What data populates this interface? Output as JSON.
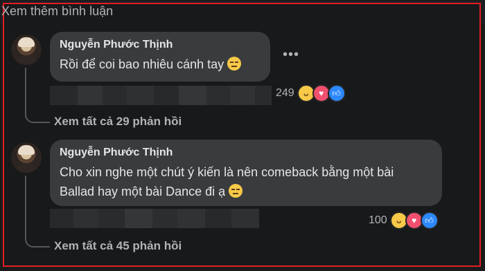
{
  "header": {
    "see_more_comments": "Xem thêm bình luận"
  },
  "comments": [
    {
      "author": "Nguyễn Phước Thịnh",
      "text": "Rồi để coi bao nhiêu cánh tay",
      "emoji": "smirking-face",
      "reaction_count": "249",
      "reactions": [
        "haha",
        "love",
        "like"
      ],
      "replies_label": "Xem tất cả 29 phản hồi"
    },
    {
      "author": "Nguyễn Phước Thịnh",
      "text_line1": "Cho xin nghe một chút ý kiến là nên comeback bằng một bài",
      "text_line2": "Ballad hay một bài Dance đi ạ",
      "emoji": "expressionless-face",
      "reaction_count": "100",
      "reactions": [
        "haha",
        "love",
        "like"
      ],
      "replies_label": "Xem tất cả 45 phản hồi"
    }
  ],
  "icons": {
    "more": "more-options-icon"
  },
  "colors": {
    "accent_border": "#e41e26",
    "like": "#2d88ff",
    "love": "#f0506e",
    "haha": "#f7c948"
  }
}
